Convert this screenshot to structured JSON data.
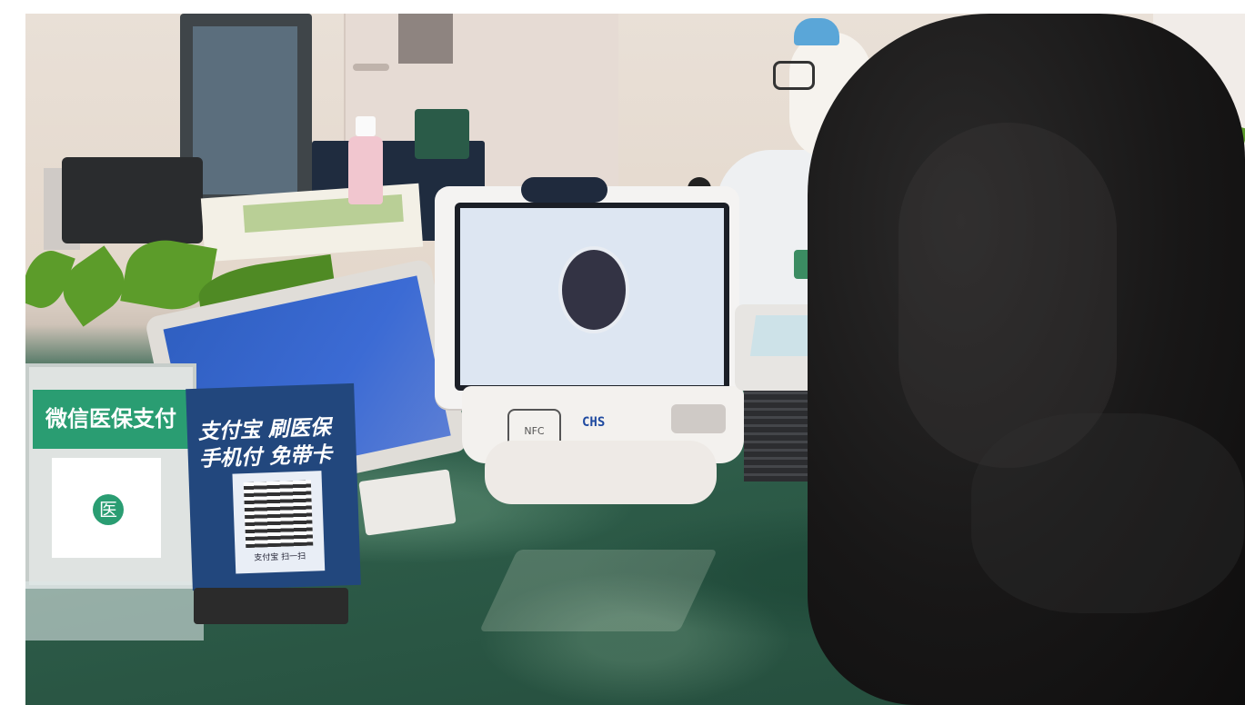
{
  "scene": {
    "qr_card_left": {
      "banner": "微信医保支付",
      "center_glyph": "医"
    },
    "qr_card_right": {
      "line1": "支付宝 刷医保",
      "line2": "手机付 免带卡",
      "caption": "支付宝 扫一扫"
    },
    "kiosk": {
      "brand": "CHS",
      "nfc_label": "NFC"
    }
  }
}
